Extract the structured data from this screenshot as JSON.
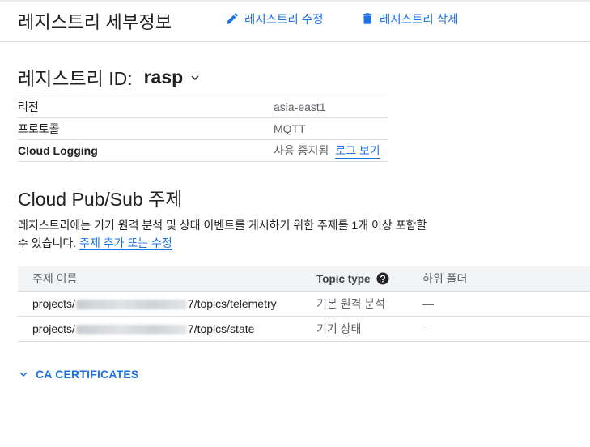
{
  "header": {
    "title": "레지스트리 세부정보",
    "edit_label": "레지스트리 수정",
    "delete_label": "레지스트리 삭제"
  },
  "registry": {
    "label": "레지스트리 ID:",
    "id": "rasp"
  },
  "properties": [
    {
      "key": "리전",
      "value": "asia-east1"
    },
    {
      "key": "프로토콜",
      "value": "MQTT"
    },
    {
      "key": "Cloud Logging",
      "value": "사용 중지됨",
      "link": "로그 보기"
    }
  ],
  "pubsub": {
    "title": "Cloud Pub/Sub 주제",
    "description_line1": "레지스트리에는 기기 원격 분석 및 상태 이벤트를 게시하기 위한 주제를 1개 이상 포함할",
    "description_line2": "수 있습니다.",
    "link": "주제 추가 또는 수정"
  },
  "topics": {
    "headers": {
      "name": "주제 이름",
      "type": "Topic type",
      "subfolder": "하위 폴더"
    },
    "rows": [
      {
        "prefix": "projects/",
        "suffix": "7/topics/telemetry",
        "type": "기본 원격 분석",
        "subfolder": "—"
      },
      {
        "prefix": "projects/",
        "suffix": "7/topics/state",
        "type": "기기 상태",
        "subfolder": "—"
      }
    ]
  },
  "ca_certificates": {
    "label": "CA CERTIFICATES"
  },
  "colors": {
    "accent": "#1a73e8",
    "text": "#202124",
    "muted": "#5f6368",
    "divider": "#dadce0",
    "table_header_bg": "#f1f3f4"
  }
}
